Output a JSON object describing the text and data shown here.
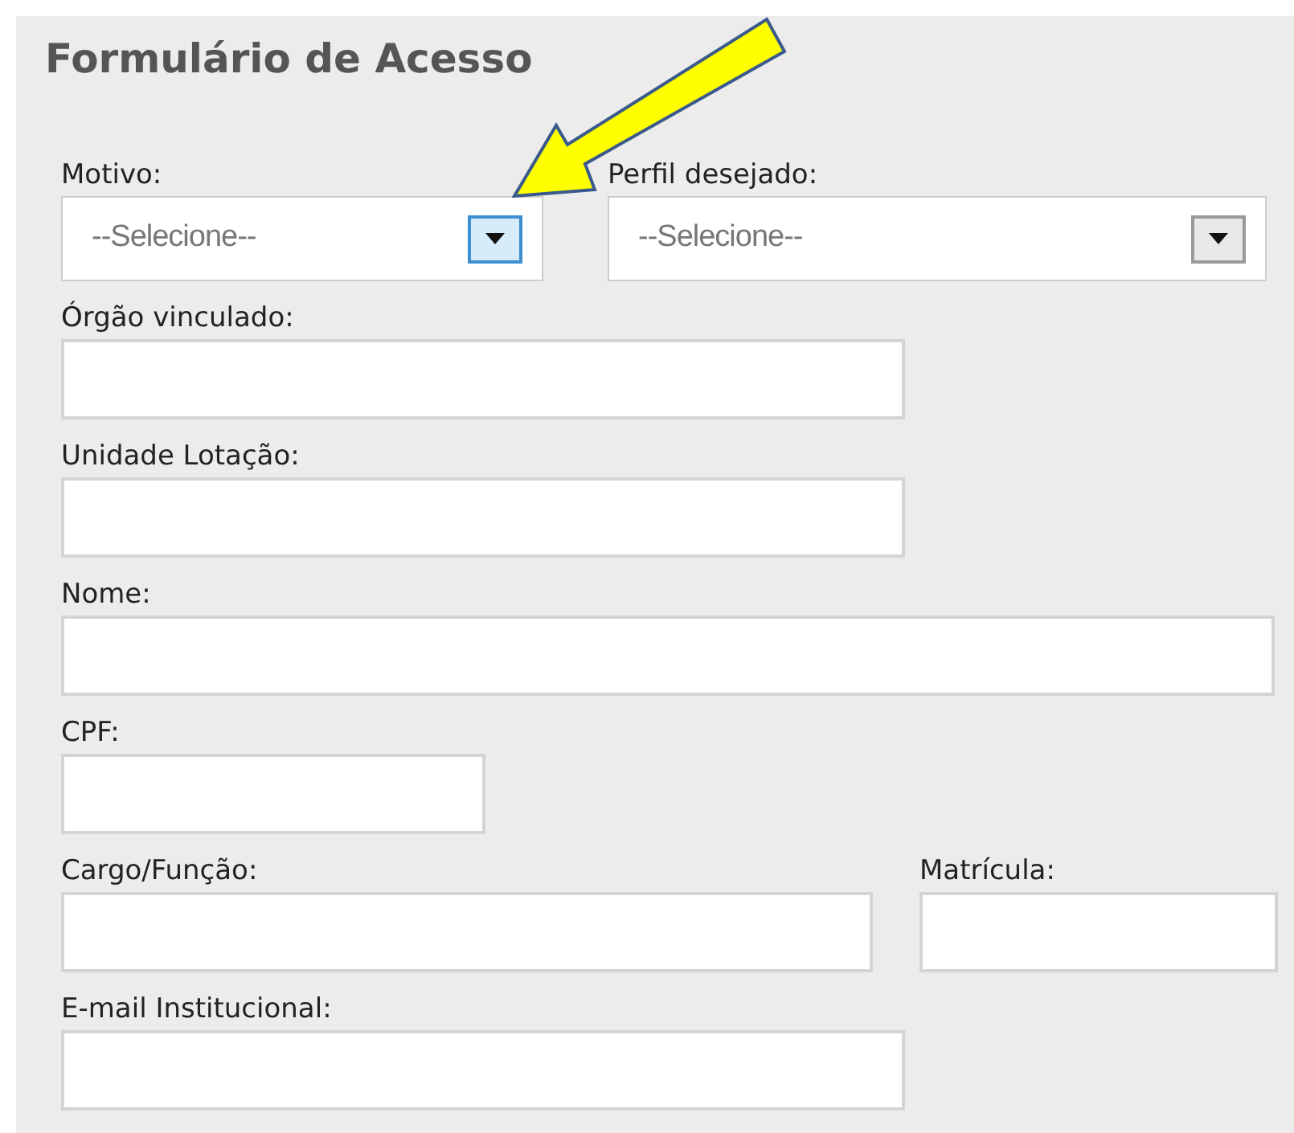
{
  "title": "Formulário de Acesso",
  "selects": [
    {
      "label": "Motivo:",
      "placeholder": "--Selecione--",
      "highlighted": true
    },
    {
      "label": "Perfil desejado:",
      "placeholder": "--Selecione--",
      "highlighted": false
    }
  ],
  "rows": [
    [
      {
        "label": "Órgão vinculado:"
      }
    ],
    [
      {
        "label": "Unidade Lotação:"
      }
    ],
    [
      {
        "label": "Nome:"
      }
    ],
    [
      {
        "label": "CPF:"
      }
    ],
    [
      {
        "label": "Cargo/Função:"
      },
      {
        "label": "Matrícula:"
      }
    ],
    [
      {
        "label": "E-mail Institucional:"
      }
    ]
  ]
}
